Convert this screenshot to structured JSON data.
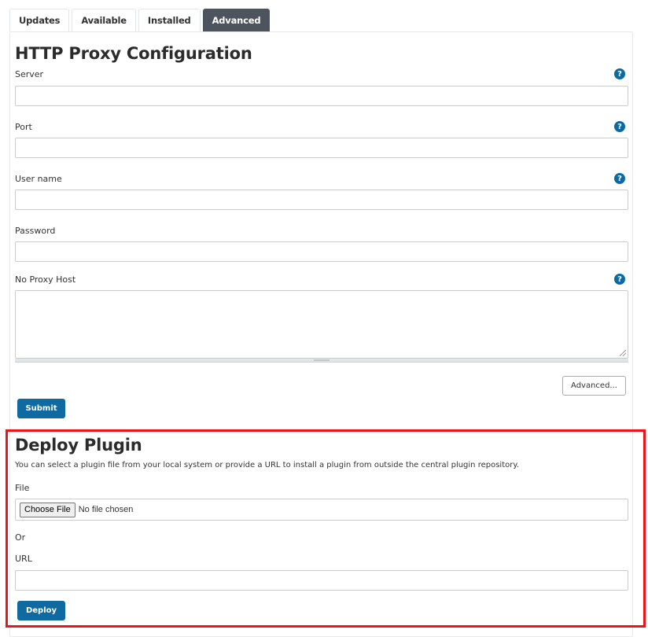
{
  "tabs": [
    {
      "label": "Updates",
      "active": false
    },
    {
      "label": "Available",
      "active": false
    },
    {
      "label": "Installed",
      "active": false
    },
    {
      "label": "Advanced",
      "active": true
    }
  ],
  "proxy": {
    "title": "HTTP Proxy Configuration",
    "fields": {
      "server": {
        "label": "Server",
        "value": "",
        "help_icon": "question-circle"
      },
      "port": {
        "label": "Port",
        "value": "",
        "help_icon": "question-circle"
      },
      "username": {
        "label": "User name",
        "value": "",
        "help_icon": "question-circle"
      },
      "password": {
        "label": "Password",
        "value": ""
      },
      "no_proxy_host": {
        "label": "No Proxy Host",
        "value": "",
        "help_icon": "question-circle"
      }
    },
    "help_glyph": "?",
    "advanced_label": "Advanced...",
    "submit_label": "Submit"
  },
  "deploy": {
    "title": "Deploy Plugin",
    "description": "You can select a plugin file from your local system or provide a URL to install a plugin from outside the central plugin repository.",
    "file_label": "File",
    "choose_file_label": "Choose File",
    "no_file_text": "No file chosen",
    "or_label": "Or",
    "url_label": "URL",
    "url_value": "",
    "deploy_label": "Deploy"
  },
  "colors": {
    "primary": "#0f6aa1",
    "active_tab": "#4d545d",
    "highlight": "#e8161b",
    "help_icon": "#0b6aa2"
  }
}
